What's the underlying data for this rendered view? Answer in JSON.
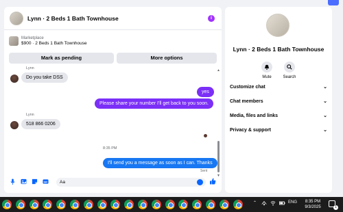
{
  "chat": {
    "title": "Lynn · 2 Beds 1 Bath Townhouse",
    "info_icon": "info-icon",
    "listing": {
      "label": "Marketplace",
      "subtitle": "$900 · 2 Beds 1 Bath Townhouse"
    },
    "buttons": {
      "mark_pending": "Mark as pending",
      "more_options": "More options"
    },
    "messages": [
      {
        "sender": "Lynn",
        "direction": "in",
        "text": "Do you take DSS"
      },
      {
        "direction": "out",
        "text": "yes"
      },
      {
        "direction": "out",
        "text": "Please share your number I'll get back to you soon."
      },
      {
        "sender": "Lynn",
        "direction": "in",
        "text": "518 866 0206"
      },
      {
        "timestamp": "8:35 PM"
      },
      {
        "direction": "out",
        "text": "I'll send you a message as soon as I can. Thanks",
        "status": "Sent"
      }
    ],
    "composer": {
      "value": "Aa",
      "icons": [
        "microphone-icon",
        "image-icon",
        "sticker-icon",
        "gif-icon",
        "emoji-icon",
        "like-icon"
      ]
    }
  },
  "info_panel": {
    "title": "Lynn · 2 Beds 1 Bath Townhouse",
    "mute_label": "Mute",
    "search_label": "Search",
    "sections": [
      "Customize chat",
      "Chat members",
      "Media, files and links",
      "Privacy & support"
    ]
  },
  "taskbar": {
    "app_icon": "chrome-icon",
    "app_count": 18,
    "language": "ENG",
    "time": "8:35 PM",
    "date": "9/3/2025",
    "notification_count": "1"
  },
  "colors": {
    "accent_purple": "#7b2ff7",
    "accent_blue": "#1877f2",
    "panel_bg": "#ffffff",
    "page_bg": "#f0f2f5",
    "taskbar_bg": "#1c1c1c"
  }
}
